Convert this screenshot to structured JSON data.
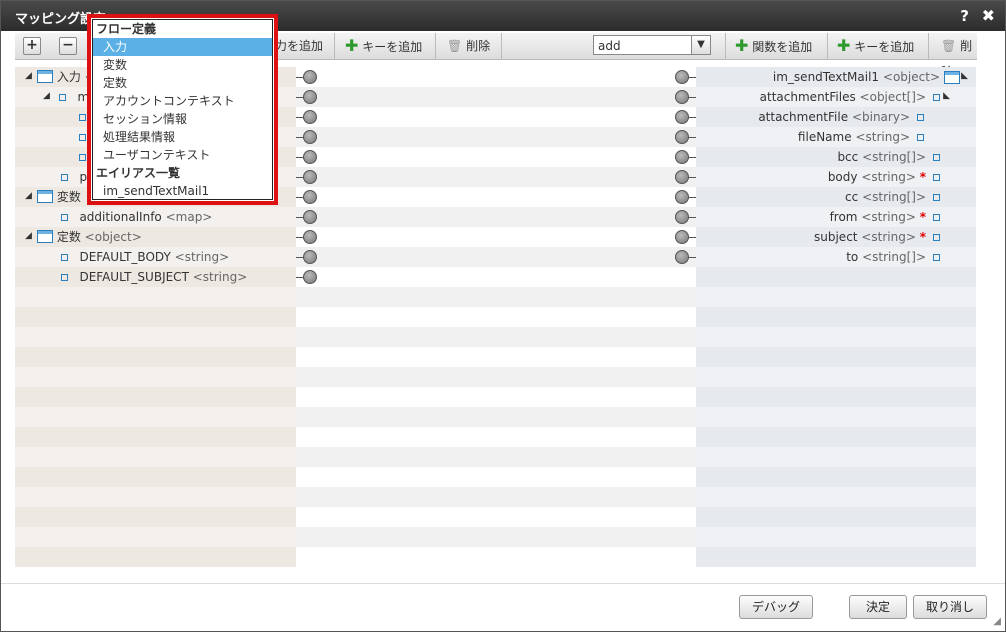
{
  "window": {
    "title": "マッピング設定",
    "help": "?",
    "close": "✖"
  },
  "toolbar": {
    "expand": "+",
    "collapse": "−",
    "add_partial": "力を追加",
    "add_key_left": "キーを追加",
    "delete_left": "削除",
    "func_select": "add",
    "add_function": "関数を追加",
    "add_key_right": "キーを追加",
    "delete_right": "削除"
  },
  "dropdown": {
    "items": [
      {
        "label": "フロー定義",
        "type": "header"
      },
      {
        "label": "入力",
        "type": "selected"
      },
      {
        "label": "変数",
        "type": "item"
      },
      {
        "label": "定数",
        "type": "item"
      },
      {
        "label": "アカウントコンテキスト",
        "type": "item"
      },
      {
        "label": "セッション情報",
        "type": "item"
      },
      {
        "label": "処理結果情報",
        "type": "item"
      },
      {
        "label": "ユーザコンテキスト",
        "type": "item"
      },
      {
        "label": "エイリアス一覧",
        "type": "header"
      },
      {
        "label": "im_sendTextMail1",
        "type": "item"
      }
    ]
  },
  "left_tree": [
    {
      "name": "入力",
      "type": "<object>"
    },
    {
      "name": "ma",
      "type": ""
    },
    {
      "name": "",
      "type": ""
    },
    {
      "name": "",
      "type": ""
    },
    {
      "name": "",
      "type": ""
    },
    {
      "name": "pa",
      "type": ""
    },
    {
      "name": "変数",
      "type": ""
    },
    {
      "name": "additionalInfo",
      "type": "<map>"
    },
    {
      "name": "定数",
      "type": "<object>"
    },
    {
      "name": "DEFAULT_BODY",
      "type": "<string>"
    },
    {
      "name": "DEFAULT_SUBJECT",
      "type": "<string>"
    }
  ],
  "right_tree": [
    {
      "name": "im_sendTextMail1",
      "type": "<object>",
      "required": false
    },
    {
      "name": "attachmentFiles",
      "type": "<object[]>",
      "required": false
    },
    {
      "name": "attachmentFile",
      "type": "<binary>",
      "required": false
    },
    {
      "name": "fileName",
      "type": "<string>",
      "required": false
    },
    {
      "name": "bcc",
      "type": "<string[]>",
      "required": false
    },
    {
      "name": "body",
      "type": "<string>",
      "required": true
    },
    {
      "name": "cc",
      "type": "<string[]>",
      "required": false
    },
    {
      "name": "from",
      "type": "<string>",
      "required": true
    },
    {
      "name": "subject",
      "type": "<string>",
      "required": true
    },
    {
      "name": "to",
      "type": "<string[]>",
      "required": false
    }
  ],
  "required_mark": "*",
  "footer": {
    "debug": "デバッグ",
    "ok": "決定",
    "cancel": "取り消し"
  }
}
